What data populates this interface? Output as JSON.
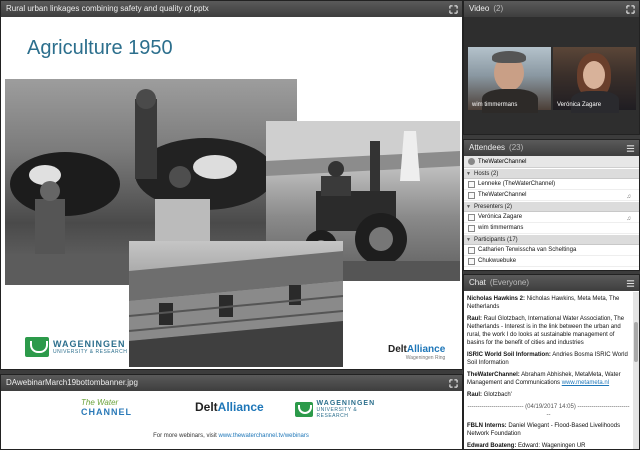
{
  "slide_pod": {
    "title": "Rural urban linkages combining safety and quality of.pptx",
    "slide_title": "Agriculture 1950",
    "logo_wur_name": "WAGENINGEN",
    "logo_wur_sub": "UNIVERSITY & RESEARCH",
    "logo_delta_pre": "Delt",
    "logo_delta_accent": "Alliance",
    "logo_delta_sub": "Wageningen Ring"
  },
  "banner_pod": {
    "title": "DAwebinarMarch19bottombanner.jpg",
    "twc_top": "The Water",
    "twc_bottom": "CHANNEL",
    "delta_pre": "Delt",
    "delta_accent": "Alliance",
    "wur_name": "WAGENINGEN",
    "wur_sub": "UNIVERSITY & RESEARCH",
    "footer_text": "For more webinars, visit",
    "footer_link": "www.thewaterchannel.tv/webinars"
  },
  "video_pod": {
    "title": "Video",
    "count": "(2)",
    "feeds": [
      {
        "name": "wim timmermans"
      },
      {
        "name": "Verónica Zagare"
      }
    ]
  },
  "attendees_pod": {
    "title": "Attendees",
    "count": "(23)",
    "room": "TheWaterChannel",
    "hosts_label": "Hosts (2)",
    "hosts": [
      "Lenneke (TheWaterChannel)",
      "TheWaterChannel"
    ],
    "presenters_label": "Presenters (2)",
    "presenters": [
      "Verónica Zagare",
      "wim timmermans"
    ],
    "participants_label": "Participants (17)",
    "participants": [
      "Catharien Terwisscha van Scheltinga",
      "Chukwuebuke"
    ]
  },
  "chat_pod": {
    "title": "Chat",
    "scope": "(Everyone)",
    "messages": [
      {
        "who": "Nicholas Hawkins 2:",
        "text": "Nicholas Hawkins, Meta Meta, The Netherlands"
      },
      {
        "who": "Raul:",
        "text": "Raul Glotzbach, International Water Association, The Netherlands - Interest is in the link between the urban and rural, the work I do looks at sustainable management of basins for the benefit of cities and industries"
      },
      {
        "who": "ISRIC World Soil Information:",
        "text": "Andries Bosma ISRIC World Soil Information"
      },
      {
        "who": "TheWaterChannel:",
        "text": "Abraham Abhishek, MetaMeta, Water Management and Communications",
        "link": "www.metameta.nl"
      },
      {
        "who": "Raul:",
        "text": "Glotzbach'"
      }
    ],
    "date_divider": "---------------------------- (04/19/2017 14:05) ----------------------------",
    "messages_after": [
      {
        "who": "FBLN Interns:",
        "text": "Daniel Wiegant - Flood-Based Livelihoods Network Foundation"
      },
      {
        "who": "Edward Boateng:",
        "text": "Edward: Wageningen UR"
      }
    ]
  },
  "colors": {
    "slide_title": "#2c6f8d",
    "link": "#1d76b8",
    "wur_green": "#2c9a4a",
    "header_bg": "#4a4a4a"
  }
}
